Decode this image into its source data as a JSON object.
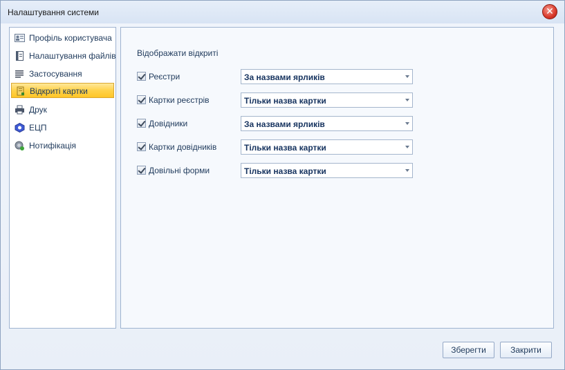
{
  "window": {
    "title": "Налаштування системи"
  },
  "sidebar": {
    "items": [
      {
        "label": "Профіль користувача",
        "icon": "profile-card-icon"
      },
      {
        "label": "Налаштування файлів",
        "icon": "file-settings-icon"
      },
      {
        "label": "Застосування",
        "icon": "lines-icon"
      },
      {
        "label": "Відкриті картки",
        "icon": "open-cards-icon",
        "active": true
      },
      {
        "label": "Друк",
        "icon": "printer-icon"
      },
      {
        "label": "ЕЦП",
        "icon": "digital-signature-icon"
      },
      {
        "label": "Нотифікація",
        "icon": "notification-icon"
      }
    ]
  },
  "content": {
    "section_label": "Відображати відкриті",
    "rows": [
      {
        "label": "Реєстри",
        "checked": true,
        "value": "За назвами ярликів"
      },
      {
        "label": "Картки реєстрів",
        "checked": true,
        "value": "Тільки назва картки"
      },
      {
        "label": "Довідники",
        "checked": true,
        "value": "За назвами ярликів"
      },
      {
        "label": "Картки довідників",
        "checked": true,
        "value": "Тільки назва картки"
      },
      {
        "label": "Довільні форми",
        "checked": true,
        "value": "Тільки назва картки"
      }
    ]
  },
  "buttons": {
    "save": "Зберегти",
    "close": "Закрити"
  },
  "colors": {
    "accent_active": "#ffd24a",
    "border": "#9eb3d0",
    "text": "#1e395b"
  }
}
